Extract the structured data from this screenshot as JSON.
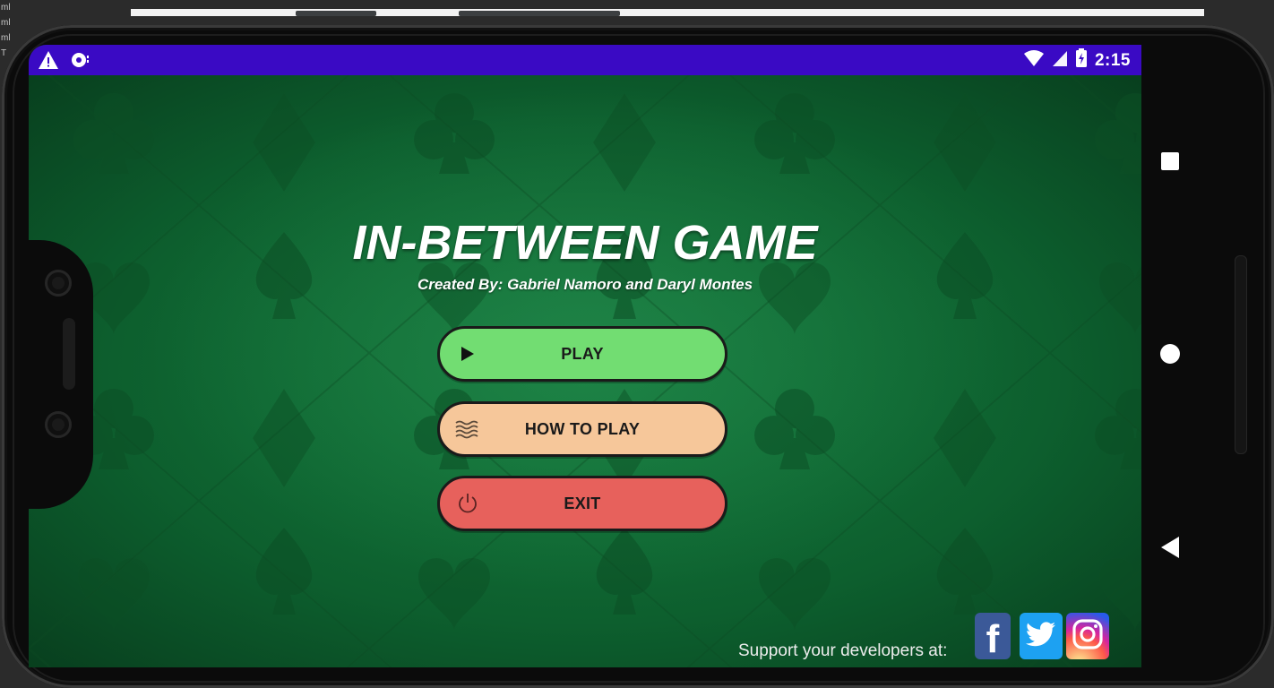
{
  "ide": {
    "sidebar_lines": [
      "ml",
      "ml",
      "ml",
      "T"
    ]
  },
  "statusbar": {
    "time": "2:15",
    "icons": [
      "warning-icon",
      "sync-icon",
      "wifi-icon",
      "signal-icon",
      "battery-icon"
    ],
    "color": "#3a0ac4"
  },
  "game": {
    "title": "IN-BETWEEN GAME",
    "subtitle": "Created By: Gabriel Namoro and Daryl Montes",
    "buttons": {
      "play": "PLAY",
      "how_to_play": "HOW TO PLAY",
      "exit": "EXIT"
    },
    "button_colors": {
      "play": "#72dd72",
      "how_to_play": "#f6c79a",
      "exit": "#e7615c"
    },
    "support_text": "Support your developers at:",
    "social": {
      "facebook": "f",
      "twitter": "twitter-bird-icon",
      "instagram": "instagram-camera-icon"
    },
    "background_color": "#0d5a2c"
  },
  "navbar": {
    "icons": [
      "recents-square-icon",
      "home-circle-icon",
      "back-triangle-icon"
    ]
  }
}
